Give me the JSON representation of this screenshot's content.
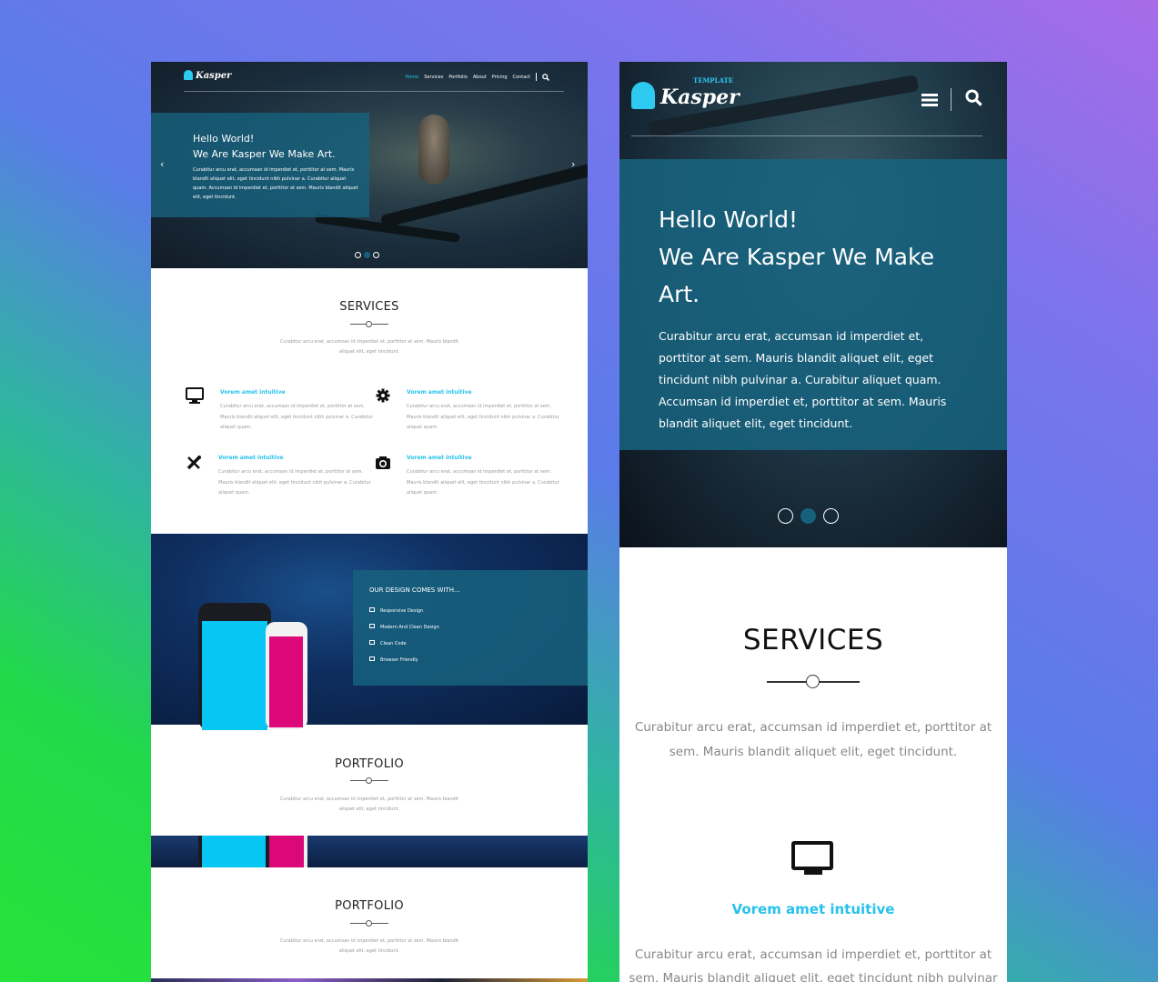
{
  "desktop": {
    "logo": "Kasper",
    "nav": [
      "Home",
      "Services",
      "Portfolio",
      "About",
      "Pricing",
      "Contact"
    ],
    "hero": {
      "title1": "Hello World!",
      "title2": "We Are Kasper We Make Art.",
      "text": "Curabitur arcu erat, accumsan id imperdiet et, porttitor at sem. Mauris blandit aliquet elit, eget tincidunt nibh pulvinar a. Curabitur aliquet quam. Accumsan id imperdiet et, porttitor at sem. Mauris blandit aliquet elit, eget tincidunt.",
      "prev_arrow": "‹",
      "next_arrow": "›",
      "active_slide": 2
    },
    "services": {
      "title": "SERVICES",
      "subtitle": "Curabitur arcu erat, accumsan id imperdiet et, porttitor at sem. Mauris blandit aliquet elit, eget tincidunt.",
      "items": [
        {
          "icon": "monitor-icon",
          "title": "Vorem amet intuitive",
          "text": "Curabitur arcu erat, accumsan id imperdiet et, porttitor at sem. Mauris blandit aliquet elit, eget tincidunt nibh pulvinar a. Curabitur aliquet quam."
        },
        {
          "icon": "gear-icon",
          "title": "Vorem amet intuitive",
          "text": "Curabitur arcu erat, accumsan id imperdiet et, porttitor at sem. Mauris blandit aliquet elit, eget tincidunt nibh pulvinar a. Curabitur aliquet quam."
        },
        {
          "icon": "design-tools-icon",
          "title": "Vorem amet intuitive",
          "text": "Curabitur arcu erat, accumsan id imperdiet et, porttitor at sem. Mauris blandit aliquet elit, eget tincidunt nibh pulvinar a. Curabitur aliquet quam."
        },
        {
          "icon": "camera-icon",
          "title": "Vorem amet intuitive",
          "text": "Curabitur arcu erat, accumsan id imperdiet et, porttitor at sem. Mauris blandit aliquet elit, eget tincidunt nibh pulvinar a. Curabitur aliquet quam."
        }
      ]
    },
    "design": {
      "title": "OUR DESIGN COMES WITH...",
      "features": [
        "Responsive Design",
        "Modern And Clean Design",
        "Clean Code",
        "Browser Friendly"
      ]
    },
    "portfolio1": {
      "title": "PORTFOLIO",
      "subtitle": "Curabitur arcu erat, accumsan id imperdiet et, porttitor at sem. Mauris blandit aliquet elit, eget tincidunt."
    },
    "portfolio2": {
      "title": "PORTFOLIO",
      "subtitle": "Curabitur arcu erat, accumsan id imperdiet et, porttitor at sem. Mauris blandit aliquet elit, eget tincidunt."
    }
  },
  "mobile": {
    "logo": "Kasper",
    "logo_tag": "TEMPLATE",
    "hero": {
      "title1": "Hello World!",
      "title2": "We Are Kasper We Make Art.",
      "text": "Curabitur arcu erat, accumsan id imperdiet et, porttitor at sem. Mauris blandit aliquet elit, eget tincidunt nibh pulvinar a. Curabitur aliquet quam. Accumsan id imperdiet et, porttitor at sem. Mauris blandit aliquet elit, eget tincidunt.",
      "active_slide": 2
    },
    "services": {
      "title": "SERVICES",
      "subtitle": "Curabitur arcu erat, accumsan id imperdiet et, porttitor at sem. Mauris blandit aliquet elit, eget tincidunt.",
      "item_icon": "monitor-icon",
      "item_title": "Vorem amet intuitive",
      "item_text": "Curabitur arcu erat, accumsan id imperdiet et, porttitor at sem. Mauris blandit aliquet elit, eget tincidunt nibh pulvinar a."
    }
  },
  "colors": {
    "accent": "#27c2ec",
    "overlay": "#17607c",
    "phone_cyan": "#08c6f4",
    "phone_pink": "#dc0778"
  }
}
